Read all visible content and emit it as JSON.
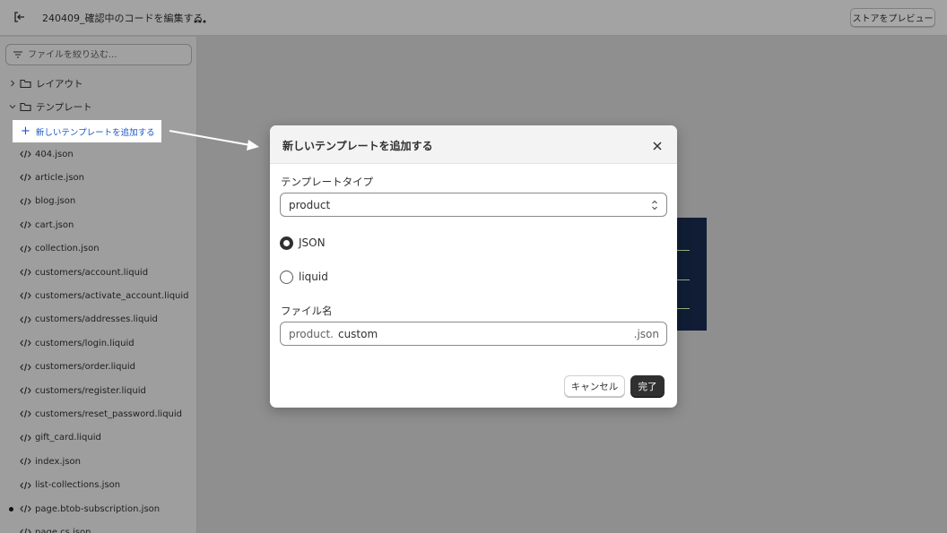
{
  "topbar": {
    "exit_icon": "exit-icon",
    "title": "240409_確認中のコードを編集する",
    "more_icon": "more-horizontal-icon",
    "preview_label": "ストアをプレビュー"
  },
  "sidebar": {
    "filter_placeholder": "ファイルを絞り込む...",
    "filter_icon": "filter-icon",
    "folders": [
      {
        "label": "レイアウト",
        "expanded": false
      },
      {
        "label": "テンプレート",
        "expanded": true
      }
    ],
    "add_template_label": "新しいテンプレートを追加する",
    "files": [
      {
        "label": "404.json",
        "modified": false
      },
      {
        "label": "article.json",
        "modified": false
      },
      {
        "label": "blog.json",
        "modified": false
      },
      {
        "label": "cart.json",
        "modified": false
      },
      {
        "label": "collection.json",
        "modified": false
      },
      {
        "label": "customers/account.liquid",
        "modified": false
      },
      {
        "label": "customers/activate_account.liquid",
        "modified": false
      },
      {
        "label": "customers/addresses.liquid",
        "modified": false
      },
      {
        "label": "customers/login.liquid",
        "modified": false
      },
      {
        "label": "customers/order.liquid",
        "modified": false
      },
      {
        "label": "customers/register.liquid",
        "modified": false
      },
      {
        "label": "customers/reset_password.liquid",
        "modified": false
      },
      {
        "label": "gift_card.liquid",
        "modified": false
      },
      {
        "label": "index.json",
        "modified": false
      },
      {
        "label": "list-collections.json",
        "modified": false
      },
      {
        "label": "page.btob-subscription.json",
        "modified": true
      },
      {
        "label": "page.cs.json",
        "modified": false
      }
    ]
  },
  "modal": {
    "title": "新しいテンプレートを追加する",
    "close_icon": "close-icon",
    "template_type_label": "テンプレートタイプ",
    "template_type_value": "product",
    "radios": [
      {
        "label": "JSON",
        "checked": true
      },
      {
        "label": "liquid",
        "checked": false
      }
    ],
    "filename_label": "ファイル名",
    "filename_prefix": "product.",
    "filename_value": "custom",
    "filename_suffix": ".json",
    "cancel_label": "キャンセル",
    "done_label": "完了"
  },
  "colors": {
    "overlay_gray": "#8f8f8f",
    "link_blue": "#1b57c6",
    "primary_dark": "#303030",
    "preview_navy": "#101d35"
  }
}
